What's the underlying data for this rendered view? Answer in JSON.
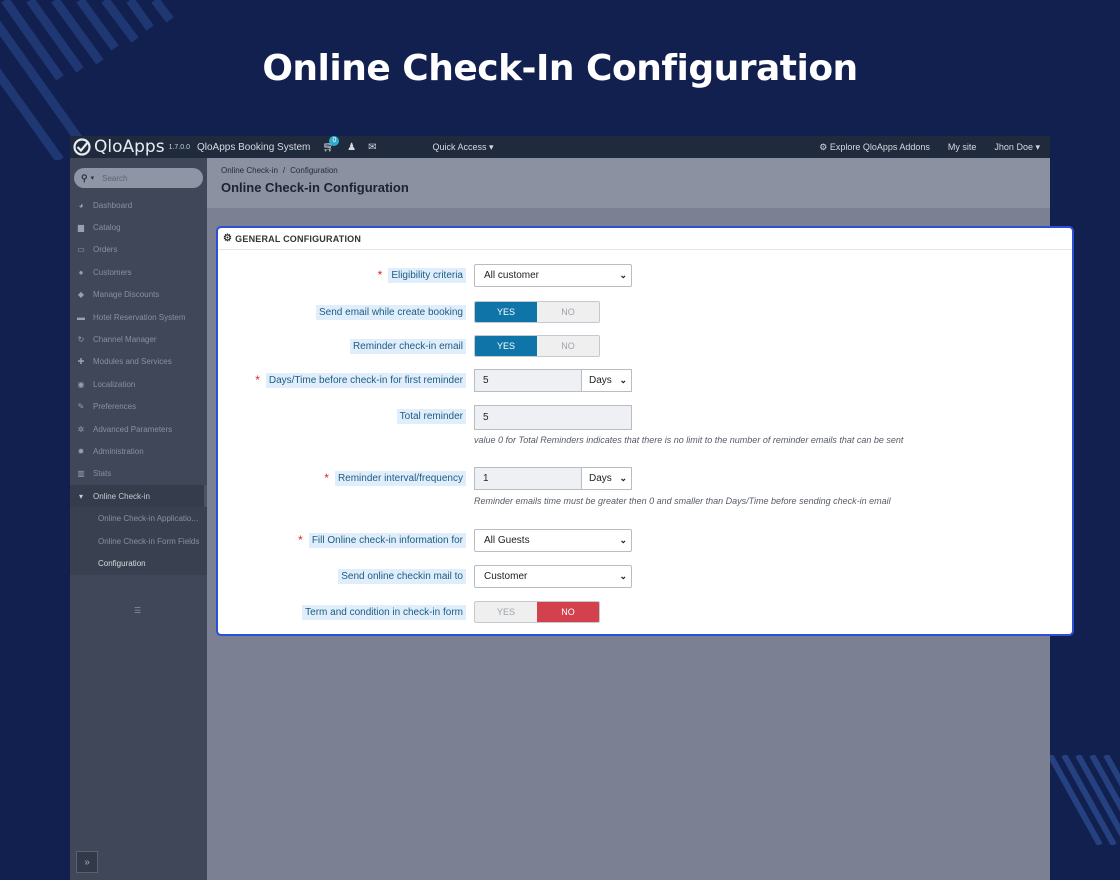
{
  "hero": {
    "title": "Online Check-In Configuration"
  },
  "topbar": {
    "logo_text": "QloApps",
    "version": "1.7.0.0",
    "system_name": "QloApps Booking System",
    "cart_count": "0",
    "quick_access": "Quick Access",
    "explore": "Explore QloApps Addons",
    "my_site": "My site",
    "user": "Jhon Doe"
  },
  "sidebar": {
    "search_placeholder": "Search",
    "items": [
      {
        "label": "Dashboard",
        "icon": "dashboard-icon",
        "glyph": "◕"
      },
      {
        "label": "Catalog",
        "icon": "book-icon",
        "glyph": "▆"
      },
      {
        "label": "Orders",
        "icon": "credit-card-icon",
        "glyph": "▭"
      },
      {
        "label": "Customers",
        "icon": "users-icon",
        "glyph": "●"
      },
      {
        "label": "Manage Discounts",
        "icon": "tag-icon",
        "glyph": "◆"
      },
      {
        "label": "Hotel Reservation System",
        "icon": "bed-icon",
        "glyph": "▬"
      },
      {
        "label": "Channel Manager",
        "icon": "refresh-icon",
        "glyph": "↻"
      },
      {
        "label": "Modules and Services",
        "icon": "puzzle-icon",
        "glyph": "✚"
      },
      {
        "label": "Localization",
        "icon": "globe-icon",
        "glyph": "◉"
      },
      {
        "label": "Preferences",
        "icon": "wrench-icon",
        "glyph": "✎"
      },
      {
        "label": "Advanced Parameters",
        "icon": "cogs-icon",
        "glyph": "✲"
      },
      {
        "label": "Administration",
        "icon": "gear-icon",
        "glyph": "✹"
      },
      {
        "label": "Stats",
        "icon": "bar-chart-icon",
        "glyph": "▥"
      },
      {
        "label": "Online Check-in",
        "icon": "cart-icon",
        "glyph": "▾"
      }
    ],
    "subitems": [
      {
        "label": "Online Check-in Applicatio..."
      },
      {
        "label": "Online Check-in Form Fields"
      },
      {
        "label": "Configuration"
      }
    ]
  },
  "header": {
    "breadcrumb_1": "Online Check-in",
    "breadcrumb_sep": "/",
    "breadcrumb_2": "Configuration",
    "title": "Online Check-in Configuration"
  },
  "panel": {
    "title": "GENERAL CONFIGURATION",
    "eligibility": {
      "label": "Eligibility criteria",
      "value": "All customer"
    },
    "send_email": {
      "label": "Send email while create booking",
      "yes": "YES",
      "no": "NO",
      "selected": "yes"
    },
    "reminder_email": {
      "label": "Reminder check-in email",
      "yes": "YES",
      "no": "NO",
      "selected": "yes"
    },
    "first_reminder": {
      "label": "Days/Time before check-in for first reminder",
      "value": "5",
      "unit": "Days"
    },
    "total_reminder": {
      "label": "Total reminder",
      "value": "5",
      "help": "value 0 for Total Reminders indicates that there is no limit to the number of reminder emails that can be sent"
    },
    "interval": {
      "label": "Reminder interval/frequency",
      "value": "1",
      "unit": "Days",
      "help": "Reminder emails time must be greater then 0 and smaller than Days/Time before sending check-in email"
    },
    "fill_info": {
      "label": "Fill Online check-in information for",
      "value": "All Guests"
    },
    "send_mail_to": {
      "label": "Send online checkin mail to",
      "value": "Customer"
    },
    "terms": {
      "label": "Term and condition in check-in form",
      "yes": "YES",
      "no": "NO",
      "selected": "no"
    }
  },
  "colors": {
    "background": "#12204f",
    "highlight_border": "#2d4fd6",
    "yes_active": "#0f75a8",
    "no_active": "#d3414d"
  }
}
